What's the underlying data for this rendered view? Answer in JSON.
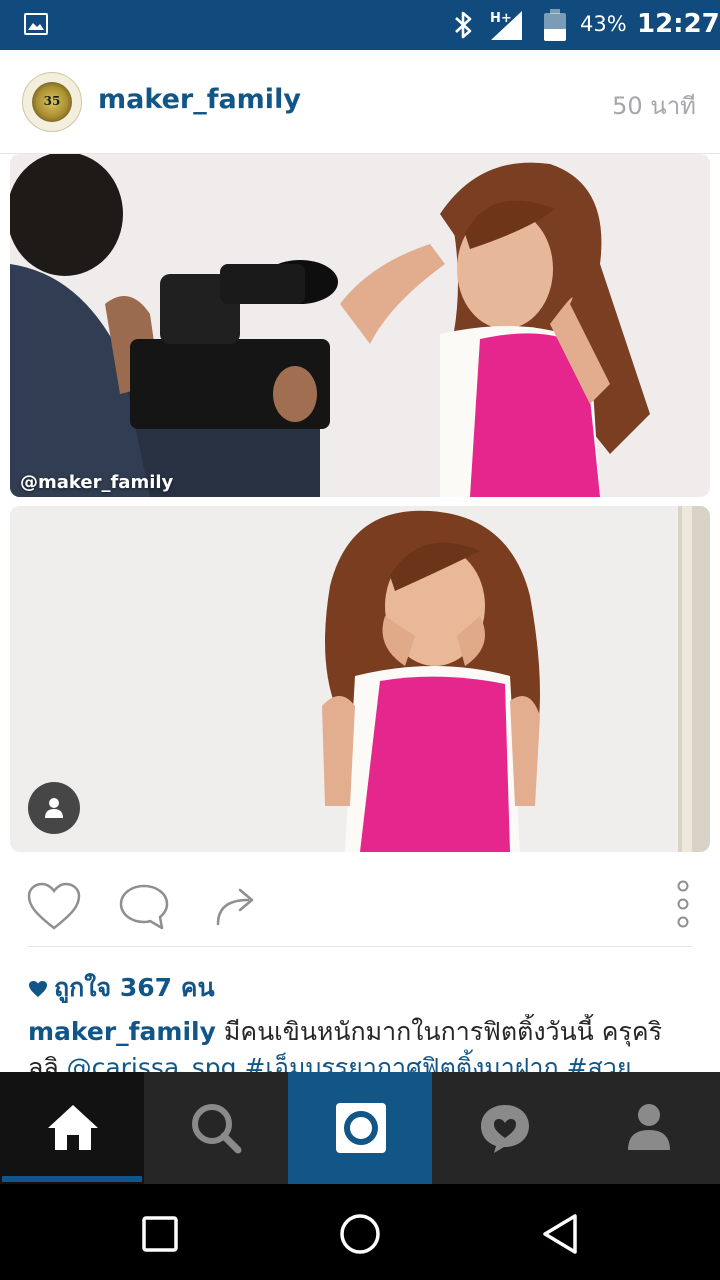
{
  "status_bar": {
    "network": "H+",
    "battery_percent": "43%",
    "battery_level": 0.43,
    "time": "12:27"
  },
  "post": {
    "username": "maker_family",
    "time_ago": "50 นาที",
    "avatar_text": "35",
    "photos": [
      {
        "watermark": "@maker_family"
      },
      {
        "watermark": ""
      }
    ],
    "likes_text": "ถูกใจ 367 คน",
    "caption": {
      "username": "maker_family",
      "text": "มีคนเขินหนักมากในการฟิตติ้งวันนี้ ครุคริ ลลิ",
      "tags": "@carissa_spg #เอ็มบรรยากาศฟิตติ้งมาฝาก #สวย"
    }
  },
  "icons": {
    "like": "heart-icon",
    "comment": "comment-icon",
    "share": "share-icon",
    "more": "more-options-icon",
    "tab_home": "home-icon",
    "tab_search": "search-icon",
    "tab_camera": "camera-icon",
    "tab_activity": "activity-heart-icon",
    "tab_profile": "profile-icon"
  },
  "colors": {
    "status_bar": "#114a7c",
    "brand_blue": "#125688",
    "tab_bar": "#262626"
  }
}
